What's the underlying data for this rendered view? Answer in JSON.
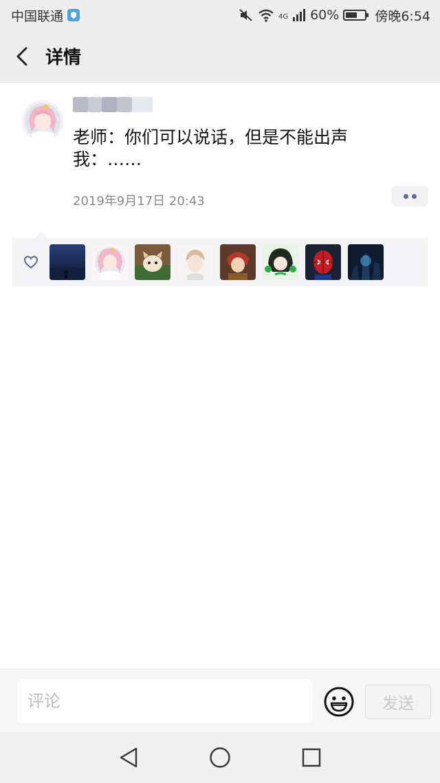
{
  "status_bar": {
    "carrier": "中国联通",
    "network": "4G",
    "battery": "60%",
    "battery_level": 0.6,
    "time": "傍晚6:54"
  },
  "nav": {
    "title": "详情"
  },
  "post": {
    "text": "老师：你们可以说话，但是不能出声\n我：……",
    "time": "2019年9月17日 20:43"
  },
  "likes": {
    "avatars": [
      "night-sky",
      "pink-anime-girl",
      "cat-illustration",
      "anime-boy-sketch",
      "anime-character",
      "green-anime",
      "spider-man",
      "blue-city"
    ]
  },
  "comment_bar": {
    "placeholder": "评论",
    "send_label": "发送"
  },
  "colors": {
    "header_bg": "#ededed",
    "likes_bg": "#f3f3f5",
    "link_blue": "#5a6b8c"
  }
}
